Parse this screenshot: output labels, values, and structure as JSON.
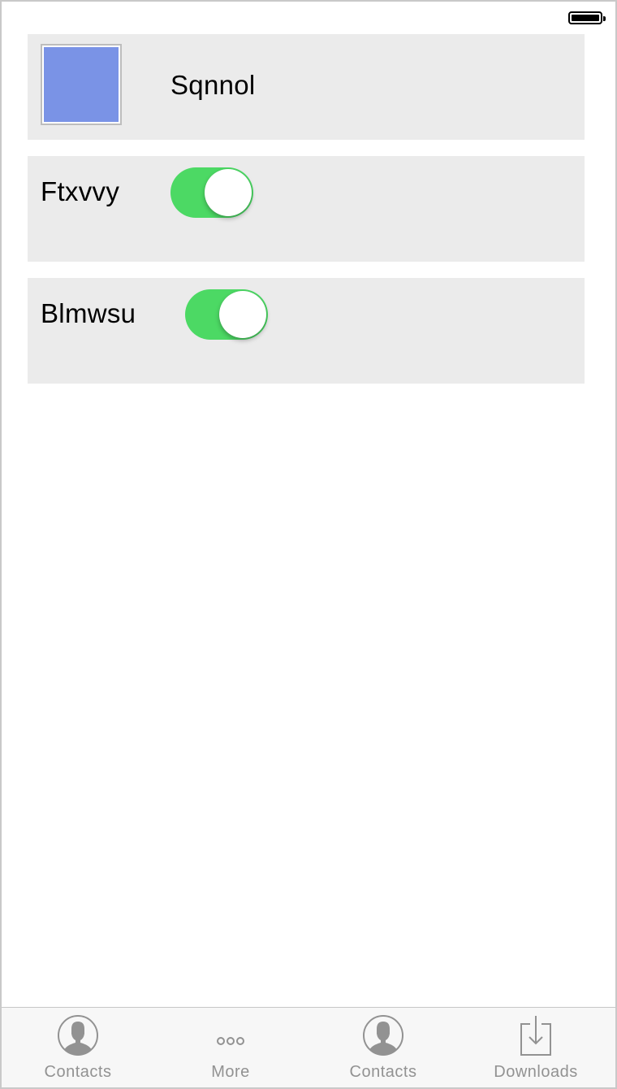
{
  "status_bar": {
    "battery_icon": "battery-full-icon"
  },
  "colors": {
    "cell_background": "#ebebeb",
    "toggle_on": "#4cd964",
    "tab_icon": "#929292",
    "tab_label": "#929292",
    "thumbnail_swatch": "#7a93e6"
  },
  "list": {
    "rows": [
      {
        "label": "Sqnnol",
        "type": "image",
        "swatch_color": "#7a93e6"
      },
      {
        "label": "Ftxvvy",
        "type": "toggle",
        "toggle_on": true
      },
      {
        "label": "Blmwsu",
        "type": "toggle",
        "toggle_on": true
      }
    ]
  },
  "tab_bar": {
    "tabs": [
      {
        "label": "Contacts",
        "icon": "contacts-icon"
      },
      {
        "label": "More",
        "icon": "more-icon"
      },
      {
        "label": "Contacts",
        "icon": "contacts-icon"
      },
      {
        "label": "Downloads",
        "icon": "downloads-icon"
      }
    ]
  }
}
